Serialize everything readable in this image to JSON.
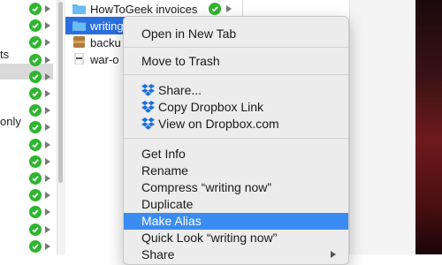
{
  "sidebar": {
    "fragments": [
      "ts",
      "only"
    ],
    "status_color": "#2fb52f"
  },
  "files": [
    {
      "name": "HowToGeek invoices",
      "icon": "folder-icon"
    },
    {
      "name": "writing",
      "icon": "folder-icon"
    },
    {
      "name": "backu",
      "icon": "archive-icon"
    },
    {
      "name": "war-o",
      "icon": "document-icon"
    }
  ],
  "context_menu": {
    "open_new_tab": "Open in New Tab",
    "move_to_trash": "Move to Trash",
    "share": "Share...",
    "copy_dropbox_link": "Copy Dropbox Link",
    "view_on_dropbox": "View on Dropbox.com",
    "get_info": "Get Info",
    "rename": "Rename",
    "compress": "Compress “writing now”",
    "duplicate": "Duplicate",
    "make_alias": "Make Alias",
    "quick_look": "Quick Look “writing now”",
    "share_sub": "Share",
    "highlight_color": "#3b8cf2",
    "dropbox_color": "#1a6fe0"
  }
}
